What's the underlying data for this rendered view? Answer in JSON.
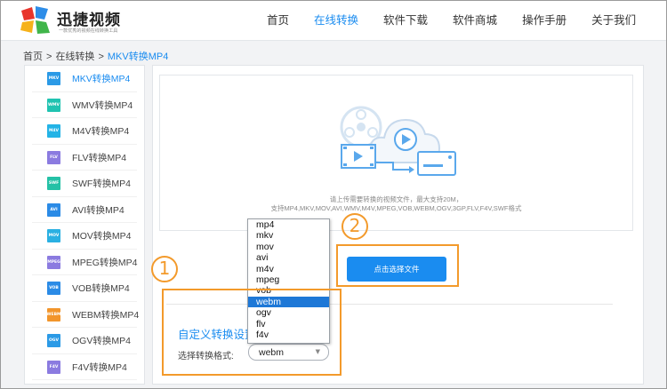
{
  "header": {
    "brand": "迅捷视频",
    "tagline": "一款优秀的视频在线转换工具",
    "nav": [
      "首页",
      "在线转换",
      "软件下载",
      "软件商城",
      "操作手册",
      "关于我们"
    ],
    "active_nav": 1
  },
  "breadcrumb": {
    "home": "首页",
    "sep": ">",
    "section": "在线转换",
    "current": "MKV转换MP4"
  },
  "sidebar": {
    "items": [
      {
        "badge": "MKV",
        "label": "MKV转换MP4",
        "color": "#2b9ae6",
        "active": true
      },
      {
        "badge": "WMV",
        "label": "WMV转换MP4",
        "color": "#20c3b1"
      },
      {
        "badge": "M4V",
        "label": "M4V转换MP4",
        "color": "#23b3e6"
      },
      {
        "badge": "FLV",
        "label": "FLV转换MP4",
        "color": "#8b7be0"
      },
      {
        "badge": "SWF",
        "label": "SWF转换MP4",
        "color": "#25c1a6"
      },
      {
        "badge": "AVI",
        "label": "AVI转换MP4",
        "color": "#2b8be6"
      },
      {
        "badge": "MOV",
        "label": "MOV转换MP4",
        "color": "#2ab0e2"
      },
      {
        "badge": "MPEG",
        "label": "MPEG转换MP4",
        "color": "#8b7be0"
      },
      {
        "badge": "VOB",
        "label": "VOB转换MP4",
        "color": "#2b8be6"
      },
      {
        "badge": "WEBM",
        "label": "WEBM转换MP4",
        "color": "#f2952b"
      },
      {
        "badge": "OGV",
        "label": "OGV转换MP4",
        "color": "#2b9ae6"
      },
      {
        "badge": "F4V",
        "label": "F4V转换MP4",
        "color": "#8b7be0"
      }
    ]
  },
  "upload": {
    "hint1": "请上传需要转换的视频文件，最大支持20M，",
    "hint2": "支持MP4,MKV,MOV,AVI,WMV,M4V,MPEG,VOB,WEBM,OGV,3GP,FLV,F4V,SWF格式",
    "button": "点击选择文件"
  },
  "settings": {
    "title": "自定义转换设置",
    "format_label": "选择转换格式:",
    "selected_format": "webm",
    "options": [
      "mp4",
      "mkv",
      "mov",
      "avi",
      "m4v",
      "mpeg",
      "vob",
      "webm",
      "ogv",
      "flv",
      "f4v"
    ]
  },
  "annotations": {
    "step1": "1",
    "step2": "2",
    "color": "#f39a2b"
  },
  "colors": {
    "accent": "#1a8cf0",
    "selected_option_bg": "#1e78d7"
  }
}
